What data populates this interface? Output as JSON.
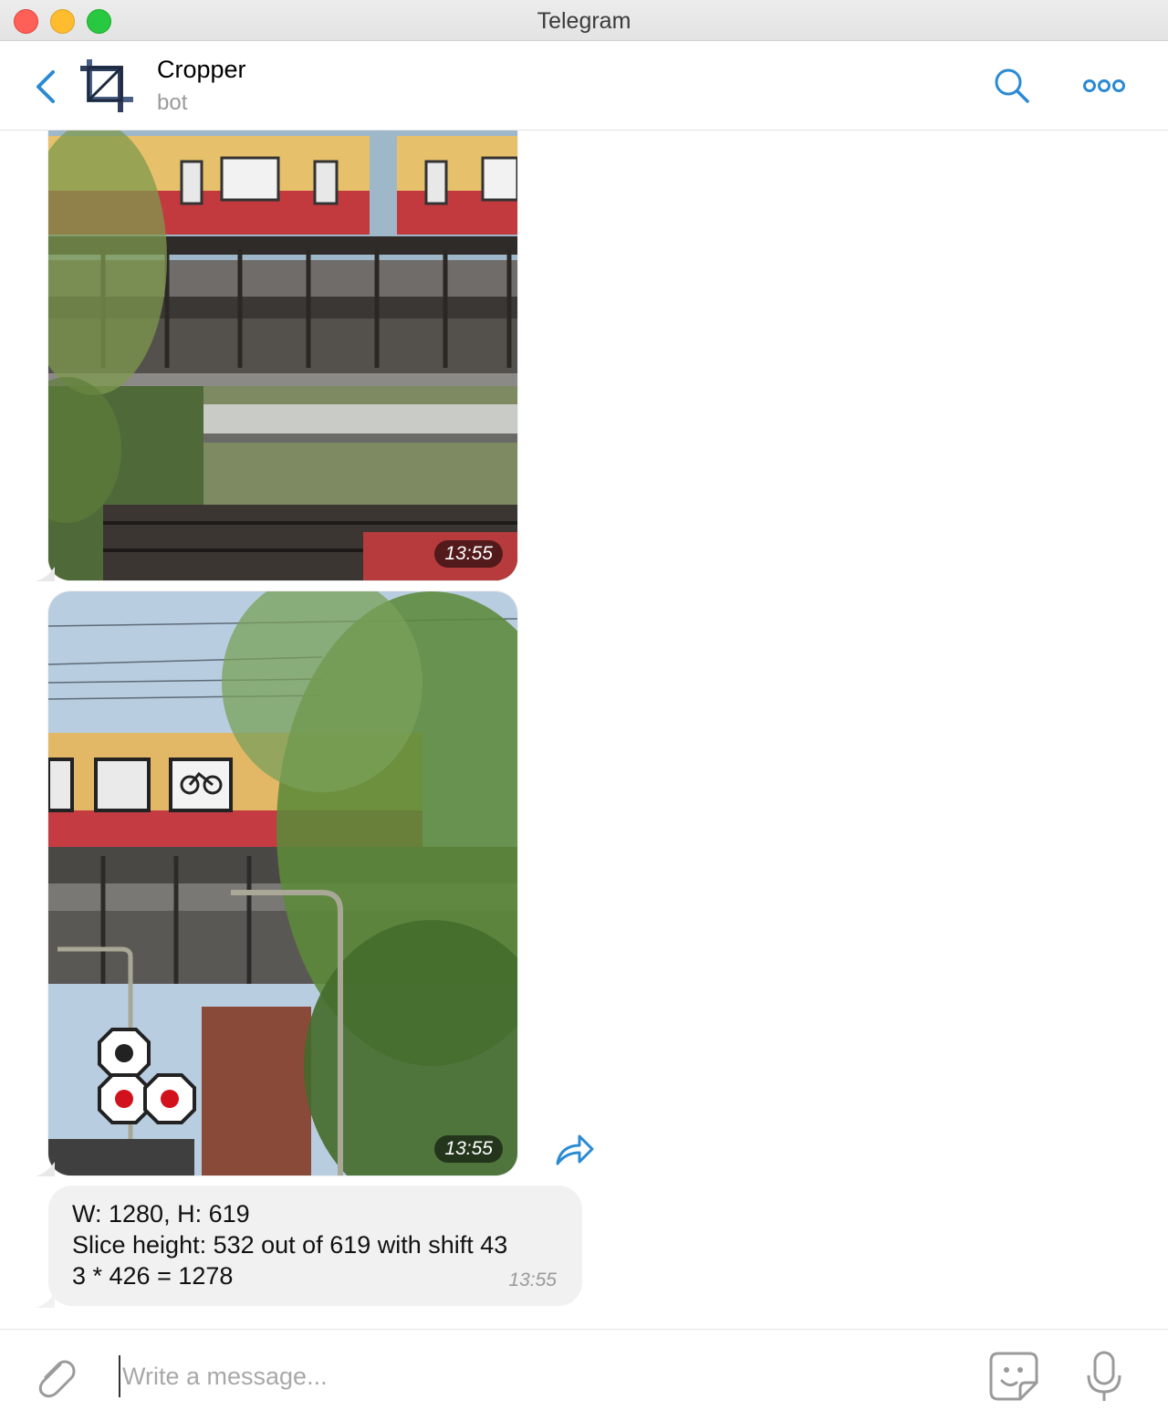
{
  "window": {
    "title": "Telegram"
  },
  "header": {
    "chat_name": "Cropper",
    "chat_subtitle": "bot",
    "icons": [
      "back-arrow-icon",
      "crop-icon",
      "search-icon",
      "more-icon"
    ],
    "accent_color": "#2a8ad4"
  },
  "messages": [
    {
      "type": "photo",
      "time": "13:55",
      "description_icon": "photo"
    },
    {
      "type": "photo",
      "time": "13:55",
      "description_icon": "photo"
    },
    {
      "type": "text",
      "lines": [
        "W: 1280, H: 619",
        "Slice height: 532 out of 619 with shift 43",
        "3 * 426 = 1278"
      ],
      "time": "13:55"
    }
  ],
  "composer": {
    "placeholder": "Write a message...",
    "icons": [
      "paperclip-icon",
      "sticker-icon",
      "microphone-icon"
    ]
  }
}
